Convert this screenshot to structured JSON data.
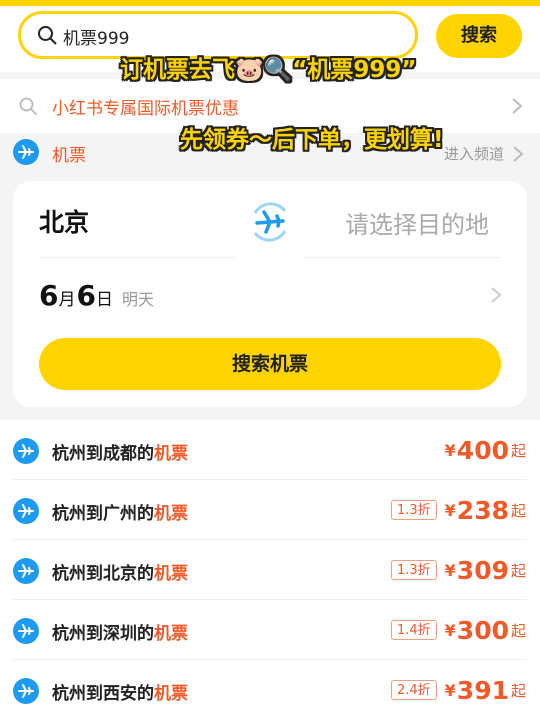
{
  "search": {
    "query": "机票999",
    "button_label": "搜索"
  },
  "suggestion": {
    "label": "小红书专属国际机票优惠"
  },
  "category": {
    "label": "机票",
    "enter_label": "进入频道"
  },
  "booking": {
    "from_city": "北京",
    "to_placeholder": "请选择目的地",
    "date": {
      "month": "6",
      "month_unit": "月",
      "day": "6",
      "day_unit": "日",
      "weekday": "明天"
    },
    "search_button": "搜索机票"
  },
  "routes": [
    {
      "prefix": "杭州到成都的",
      "highlight": "机票",
      "discount": "",
      "currency": "¥",
      "price": "400",
      "suffix": "起"
    },
    {
      "prefix": "杭州到广州的",
      "highlight": "机票",
      "discount": "1.3折",
      "currency": "¥",
      "price": "238",
      "suffix": "起"
    },
    {
      "prefix": "杭州到北京的",
      "highlight": "机票",
      "discount": "1.3折",
      "currency": "¥",
      "price": "309",
      "suffix": "起"
    },
    {
      "prefix": "杭州到深圳的",
      "highlight": "机票",
      "discount": "1.4折",
      "currency": "¥",
      "price": "300",
      "suffix": "起"
    },
    {
      "prefix": "杭州到西安的",
      "highlight": "机票",
      "discount": "2.4折",
      "currency": "¥",
      "price": "391",
      "suffix": "起"
    }
  ],
  "overlay": {
    "line1": "订机票去飞🐷🔍“机票999”",
    "line2": "先领券～后下单，更划算!"
  },
  "colors": {
    "brand_yellow": "#ffd400",
    "accent_orange": "#f05a28",
    "plane_blue": "#1e9bf0"
  },
  "icons": [
    "search-icon",
    "plane-icon",
    "swap-plane-icon",
    "chevron-right-icon"
  ]
}
